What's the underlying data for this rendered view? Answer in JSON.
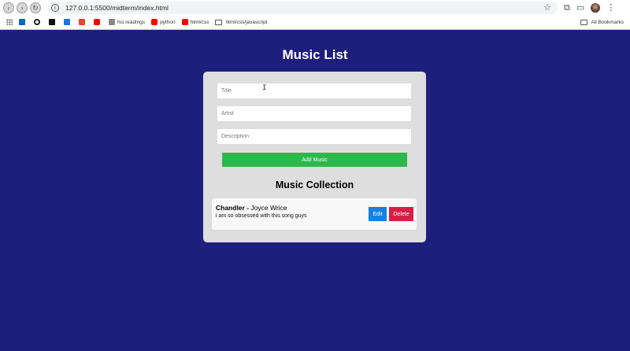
{
  "browser": {
    "url": "127.0.0.1:5500/midterm/index.html",
    "bookmarks": [
      {
        "label": "",
        "color": "#0a66c2"
      },
      {
        "label": "",
        "color": "#222222"
      },
      {
        "label": "",
        "color": "#111111"
      },
      {
        "label": "",
        "color": "#1a73e8"
      },
      {
        "label": "",
        "color": "#ea4335"
      },
      {
        "label": "",
        "color": "#ff0000"
      },
      {
        "label": "hci readings",
        "color": "#888888"
      },
      {
        "label": "python",
        "color": "#ff0000"
      },
      {
        "label": "html/css",
        "color": "#ff0000"
      },
      {
        "label": "html/css/javascript",
        "color": "folder"
      }
    ],
    "all_bookmarks_label": "All Bookmarks"
  },
  "page": {
    "title": "Music List"
  },
  "form": {
    "title_placeholder": "Title",
    "artist_placeholder": "Artist",
    "description_placeholder": "Description",
    "add_button": "Add Music"
  },
  "collection": {
    "heading": "Music Collection",
    "items": [
      {
        "song": "Chandler",
        "separator": " - ",
        "artist": "Joyce Wrice",
        "description": "i am so obsessed with this song guys",
        "edit_label": "Edit",
        "delete_label": "Delete"
      }
    ]
  },
  "colors": {
    "background": "#1e1e7c",
    "card": "#dedede",
    "add_button": "#2db84a",
    "edit_button": "#1a7fe0",
    "delete_button": "#d61f46"
  }
}
